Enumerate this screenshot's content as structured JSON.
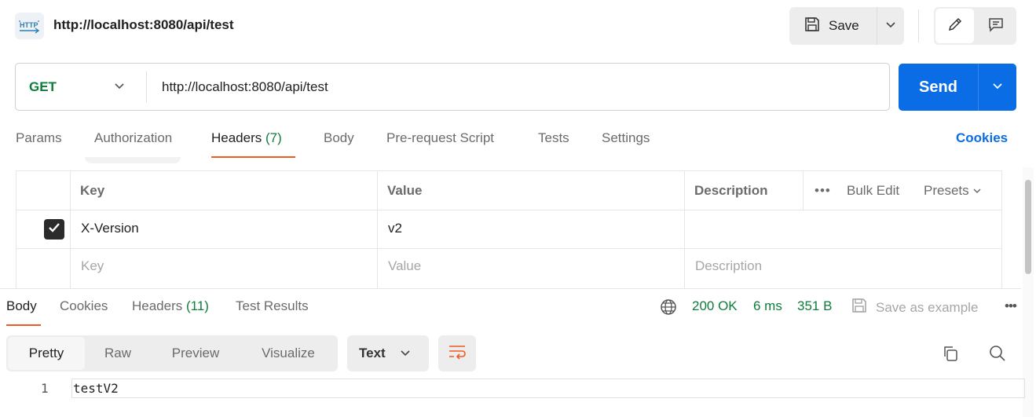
{
  "header": {
    "title": "http://localhost:8080/api/test",
    "icon": "http-icon",
    "save_label": "Save"
  },
  "request": {
    "method": "GET",
    "url": "http://localhost:8080/api/test",
    "send_label": "Send",
    "method_color": "#0d7d3c",
    "send_color": "#0b6de6"
  },
  "request_tabs": {
    "params": "Params",
    "authorization": "Authorization",
    "headers": "Headers",
    "headers_count": "(7)",
    "body": "Body",
    "pre_request": "Pre-request Script",
    "tests": "Tests",
    "settings": "Settings",
    "cookies": "Cookies",
    "active": "Headers",
    "active_color": "#ef5b25"
  },
  "headers_table": {
    "columns": {
      "key": "Key",
      "value": "Value",
      "description": "Description"
    },
    "bulk_edit": "Bulk Edit",
    "presets": "Presets",
    "rows": [
      {
        "checked": true,
        "key": "X-Version",
        "value": "v2",
        "description": ""
      }
    ],
    "placeholders": {
      "key": "Key",
      "value": "Value",
      "description": "Description"
    }
  },
  "response": {
    "tabs": {
      "body": "Body",
      "cookies": "Cookies",
      "headers": "Headers",
      "headers_count": "(11)",
      "test_results": "Test Results"
    },
    "status": "200 OK",
    "time": "6 ms",
    "size": "351 B",
    "save_example": "Save as example",
    "view_modes": [
      "Pretty",
      "Raw",
      "Preview",
      "Visualize"
    ],
    "active_view": "Pretty",
    "format": "Text",
    "lines": [
      {
        "number": "1",
        "text": "testV2"
      }
    ],
    "status_color": "#0d7d3c"
  }
}
